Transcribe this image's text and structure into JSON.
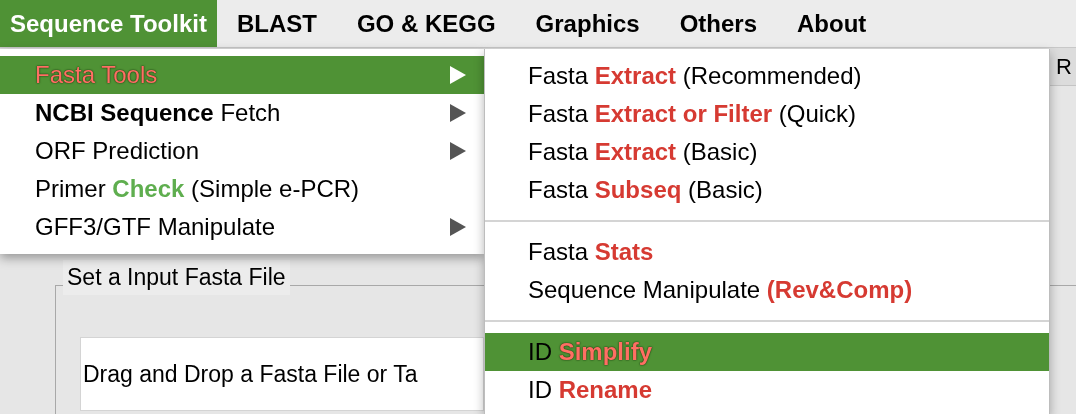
{
  "menubar": [
    {
      "label": "Sequence Toolkit",
      "selected": true
    },
    {
      "label": "BLAST",
      "selected": false
    },
    {
      "label": "GO & KEGG",
      "selected": false
    },
    {
      "label": "Graphics",
      "selected": false
    },
    {
      "label": "Others",
      "selected": false
    },
    {
      "label": "About",
      "selected": false
    }
  ],
  "menu": {
    "items": [
      {
        "parts": [
          {
            "text": "Fasta Tools",
            "kind": "red"
          }
        ],
        "submenu": true,
        "selected": true
      },
      {
        "parts": [
          {
            "text": "NCBI Sequence",
            "kind": "bold"
          },
          {
            "text": " Fetch",
            "kind": "plain"
          }
        ],
        "submenu": true,
        "selected": false
      },
      {
        "parts": [
          {
            "text": "ORF Prediction",
            "kind": "plain"
          }
        ],
        "submenu": true,
        "selected": false
      },
      {
        "parts": [
          {
            "text": "Primer ",
            "kind": "plain"
          },
          {
            "text": "Check",
            "kind": "green"
          },
          {
            "text": " (Simple e-PCR)",
            "kind": "plain"
          }
        ],
        "submenu": false,
        "selected": false
      },
      {
        "parts": [
          {
            "text": "GFF3/GTF Manipulate",
            "kind": "plain"
          }
        ],
        "submenu": true,
        "selected": false
      }
    ]
  },
  "submenu": {
    "groups": [
      [
        {
          "parts": [
            {
              "text": "Fasta ",
              "kind": "plain"
            },
            {
              "text": "Extract",
              "kind": "red"
            },
            {
              "text": " (Recommended)",
              "kind": "plain"
            }
          ],
          "selected": false
        },
        {
          "parts": [
            {
              "text": "Fasta ",
              "kind": "plain"
            },
            {
              "text": "Extract or Filter",
              "kind": "red"
            },
            {
              "text": " (Quick)",
              "kind": "plain"
            }
          ],
          "selected": false
        },
        {
          "parts": [
            {
              "text": "Fasta ",
              "kind": "plain"
            },
            {
              "text": "Extract",
              "kind": "red"
            },
            {
              "text": " (Basic)",
              "kind": "plain"
            }
          ],
          "selected": false
        },
        {
          "parts": [
            {
              "text": "Fasta ",
              "kind": "plain"
            },
            {
              "text": "Subseq",
              "kind": "red"
            },
            {
              "text": " (Basic)",
              "kind": "plain"
            }
          ],
          "selected": false
        }
      ],
      [
        {
          "parts": [
            {
              "text": "Fasta ",
              "kind": "plain"
            },
            {
              "text": "Stats",
              "kind": "red"
            }
          ],
          "selected": false
        },
        {
          "parts": [
            {
              "text": "Sequence Manipulate ",
              "kind": "plain"
            },
            {
              "text": "(Rev&Comp)",
              "kind": "red"
            }
          ],
          "selected": false
        }
      ],
      [
        {
          "parts": [
            {
              "text": "ID ",
              "kind": "plain"
            },
            {
              "text": "Simplify",
              "kind": "red"
            }
          ],
          "selected": true
        },
        {
          "parts": [
            {
              "text": "ID ",
              "kind": "plain"
            },
            {
              "text": "Rename",
              "kind": "red"
            }
          ],
          "selected": false
        }
      ]
    ]
  },
  "background": {
    "tab_fragment": "R",
    "group_title": "Set a Input Fasta File",
    "drop_field": "Drag and Drop a Fasta File or Ta"
  }
}
